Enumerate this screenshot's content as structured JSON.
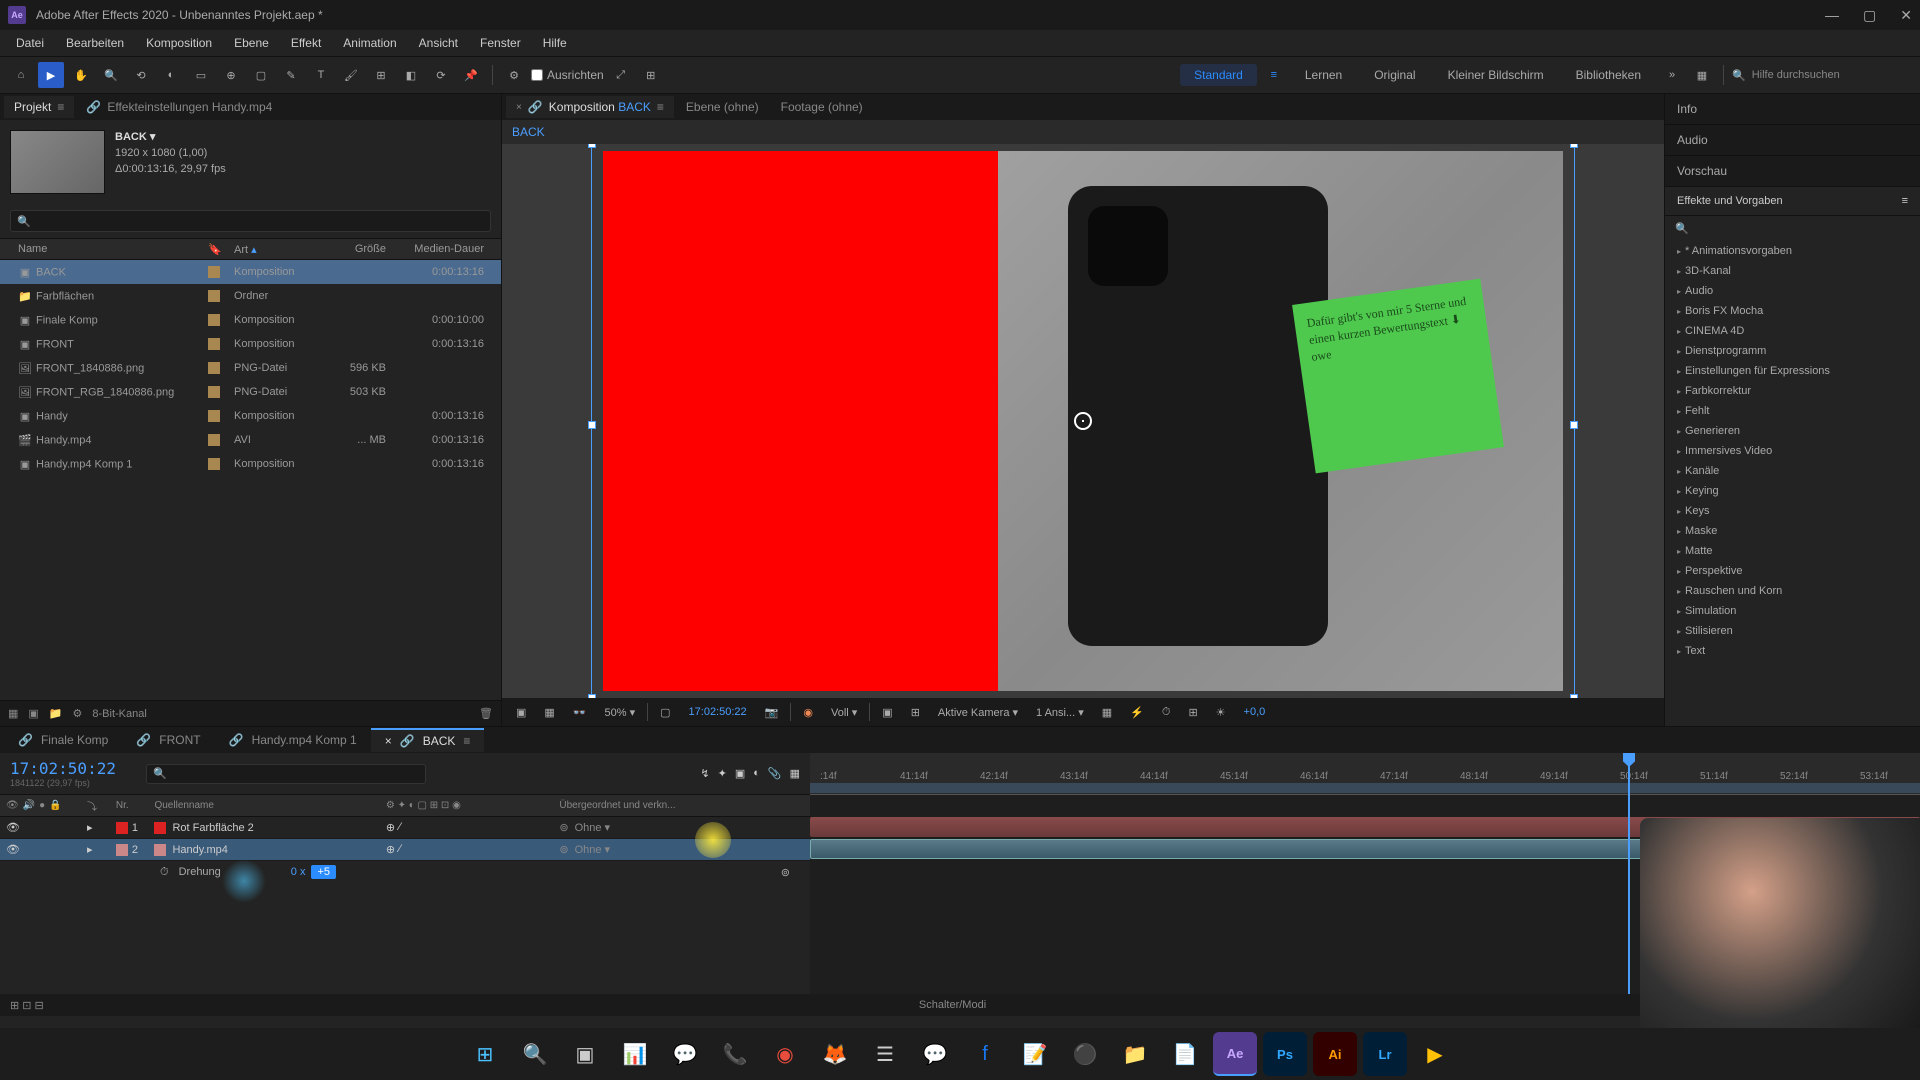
{
  "titlebar": {
    "app_title": "Adobe After Effects 2020 - Unbenanntes Projekt.aep *",
    "logo_text": "Ae"
  },
  "menubar": [
    "Datei",
    "Bearbeiten",
    "Komposition",
    "Ebene",
    "Effekt",
    "Animation",
    "Ansicht",
    "Fenster",
    "Hilfe"
  ],
  "toolbar": {
    "checkbox_label": "Ausrichten",
    "workspaces": {
      "active": "Standard",
      "items": [
        "Lernen",
        "Original",
        "Kleiner Bildschirm",
        "Bibliotheken"
      ]
    },
    "search_placeholder": "Hilfe durchsuchen"
  },
  "panel_tabs": {
    "project": "Projekt",
    "effect_controls": "Effekteinstellungen  Handy.mp4",
    "composition_prefix": "Komposition",
    "composition_name": "BACK",
    "layer_tab": "Ebene (ohne)",
    "footage_tab": "Footage  (ohne)"
  },
  "project": {
    "selected": {
      "name": "BACK",
      "resolution": "1920 x 1080 (1,00)",
      "duration": "Δ0:00:13:16, 29,97 fps"
    },
    "columns": {
      "name": "Name",
      "type": "Art",
      "size": "Größe",
      "duration": "Medien-Dauer"
    },
    "items": [
      {
        "name": "BACK",
        "type": "Komposition",
        "size": "",
        "duration": "0:00:13:16",
        "selected": true,
        "icon": "comp"
      },
      {
        "name": "Farbflächen",
        "type": "Ordner",
        "size": "",
        "duration": "",
        "icon": "folder"
      },
      {
        "name": "Finale Komp",
        "type": "Komposition",
        "size": "",
        "duration": "0:00:10:00",
        "icon": "comp"
      },
      {
        "name": "FRONT",
        "type": "Komposition",
        "size": "",
        "duration": "0:00:13:16",
        "icon": "comp"
      },
      {
        "name": "FRONT_1840886.png",
        "type": "PNG-Datei",
        "size": "596 KB",
        "duration": "",
        "icon": "png"
      },
      {
        "name": "FRONT_RGB_1840886.png",
        "type": "PNG-Datei",
        "size": "503 KB",
        "duration": "",
        "icon": "png"
      },
      {
        "name": "Handy",
        "type": "Komposition",
        "size": "",
        "duration": "0:00:13:16",
        "icon": "comp"
      },
      {
        "name": "Handy.mp4",
        "type": "AVI",
        "size": "... MB",
        "duration": "0:00:13:16",
        "icon": "video"
      },
      {
        "name": "Handy.mp4 Komp 1",
        "type": "Komposition",
        "size": "",
        "duration": "0:00:13:16",
        "icon": "comp"
      }
    ],
    "footer_depth": "8-Bit-Kanal"
  },
  "comp": {
    "breadcrumb": "BACK",
    "sticky_note_text": "Dafür gibt's von mir 5 Sterne und einen kurzen Bewertungstext ⬇ owe",
    "toolbar": {
      "zoom": "50%",
      "timecode": "17:02:50:22",
      "resolution": "Voll",
      "camera": "Aktive Kamera",
      "views": "1 Ansi...",
      "exposure": "+0,0"
    }
  },
  "right_panels": {
    "info": "Info",
    "audio": "Audio",
    "preview": "Vorschau",
    "effects_title": "Effekte und Vorgaben",
    "categories": [
      "* Animationsvorgaben",
      "3D-Kanal",
      "Audio",
      "Boris FX Mocha",
      "CINEMA 4D",
      "Dienstprogramm",
      "Einstellungen für Expressions",
      "Farbkorrektur",
      "Fehlt",
      "Generieren",
      "Immersives Video",
      "Kanäle",
      "Keying",
      "Keys",
      "Maske",
      "Matte",
      "Perspektive",
      "Rauschen und Korn",
      "Simulation",
      "Stilisieren",
      "Text"
    ]
  },
  "timeline": {
    "tabs": [
      "Finale Komp",
      "FRONT",
      "Handy.mp4 Komp 1",
      "BACK"
    ],
    "active_tab": "BACK",
    "timecode": "17:02:50:22",
    "frames_label": "1841122 (29,97 fps)",
    "head_cols": {
      "nr": "Nr.",
      "source": "Quellenname",
      "parent": "Übergeordnet und verkn..."
    },
    "ticks": [
      ":14f",
      "41:14f",
      "42:14f",
      "43:14f",
      "44:14f",
      "45:14f",
      "46:14f",
      "47:14f",
      "48:14f",
      "49:14f",
      "50:14f",
      "51:14f",
      "52:14f",
      "53:14f"
    ],
    "layers": [
      {
        "num": "1",
        "name": "Rot Farbfläche 2",
        "color": "#d22",
        "parent": "Ohne"
      },
      {
        "num": "2",
        "name": "Handy.mp4",
        "color": "#c88",
        "parent": "Ohne",
        "selected": true
      }
    ],
    "prop_name": "Drehung",
    "prop_value_prefix": "0 x",
    "prop_value_highlight": "+5",
    "footer": "Schalter/Modi"
  },
  "colors": {
    "accent": "#4a9eff",
    "red_solid": "#ff0000",
    "sticky": "#4ec94e"
  }
}
